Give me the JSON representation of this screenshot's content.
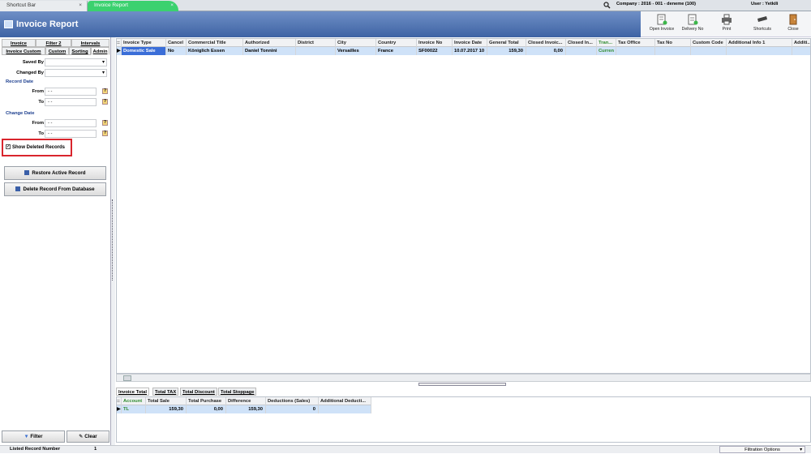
{
  "tabs": [
    {
      "label": "Shortcut Bar"
    },
    {
      "label": "Invoice Report"
    }
  ],
  "tab_close": "×",
  "company": "Company : 2016 - 001 - deneme (100)",
  "user": "User : Yetkili",
  "title": "Invoice Report",
  "toolbar": {
    "open_invoice": "Open Invoice",
    "delivery_no": "Delivery No",
    "print": "Print",
    "shortcuts": "Shortcuts",
    "close": "Close"
  },
  "left_tabs": [
    "Invoice",
    "Filter 2",
    "Intervals",
    "Invoice Custom",
    "Custom",
    "Sorting",
    "Admin"
  ],
  "filters": {
    "saved_by": "Saved By",
    "changed_by": "Changed By",
    "record_date": "Record Date",
    "change_date": "Change Date",
    "from": "From",
    "to": "To",
    "date_placeholder": "- -"
  },
  "show_deleted": "Show Deleted Records",
  "buttons": {
    "restore": "Restore Active Record",
    "delete": "Delete Record From Database",
    "filter": "Filter",
    "clear": "Clear"
  },
  "grid": {
    "columns": [
      "Invoice Type",
      "Cancel",
      "Commercial Title",
      "Authorized",
      "District",
      "City",
      "Country",
      "Invoice No",
      "Invoice Date",
      "General Total",
      "Closed Invoic...",
      "Closed In...",
      "Tran...",
      "Tax Office",
      "Tax No",
      "Custom Code",
      "Additional Info 1",
      "Additi..."
    ],
    "rows": [
      [
        "Domestic Sale",
        "No",
        "Königlich Essen",
        "Daniel  Tonnini",
        "",
        "Versailles",
        "France",
        "SF00022",
        "10.07.2017 10",
        "159,30",
        "0,00",
        "",
        "Curren",
        "",
        "",
        "",
        "",
        ""
      ]
    ]
  },
  "bottom_tabs": [
    "Invoice Total",
    "Total TAX",
    "Total Discount",
    "Total Stoppage"
  ],
  "bottom_grid": {
    "columns": [
      "Account",
      "Total Sale",
      "Total Purchase",
      "Difference",
      "Deductions (Sales)",
      "Additional Deducti..."
    ],
    "rows": [
      [
        "TL",
        "159,30",
        "0,00",
        "159,30",
        "0",
        ""
      ]
    ]
  },
  "status": {
    "label": "Listed Record Number",
    "value": "1",
    "filtration": "Filtration Options"
  }
}
